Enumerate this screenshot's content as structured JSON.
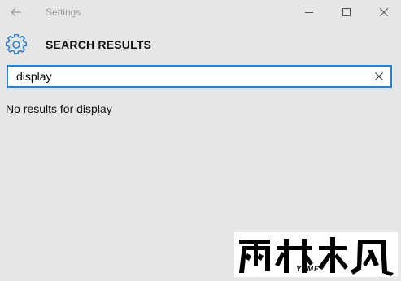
{
  "window": {
    "title": "Settings"
  },
  "header": {
    "title": "SEARCH RESULTS",
    "icon": "gear-icon"
  },
  "search": {
    "value": "display",
    "clear_icon": "close-icon"
  },
  "results": {
    "message": "No results for display"
  },
  "watermark": {
    "main_text": "雨林木风",
    "sub_text": "YLMF"
  },
  "colors": {
    "background": "#e6e6e6",
    "accent": "#2f7fd0",
    "title_gray": "#9a9a9a"
  }
}
